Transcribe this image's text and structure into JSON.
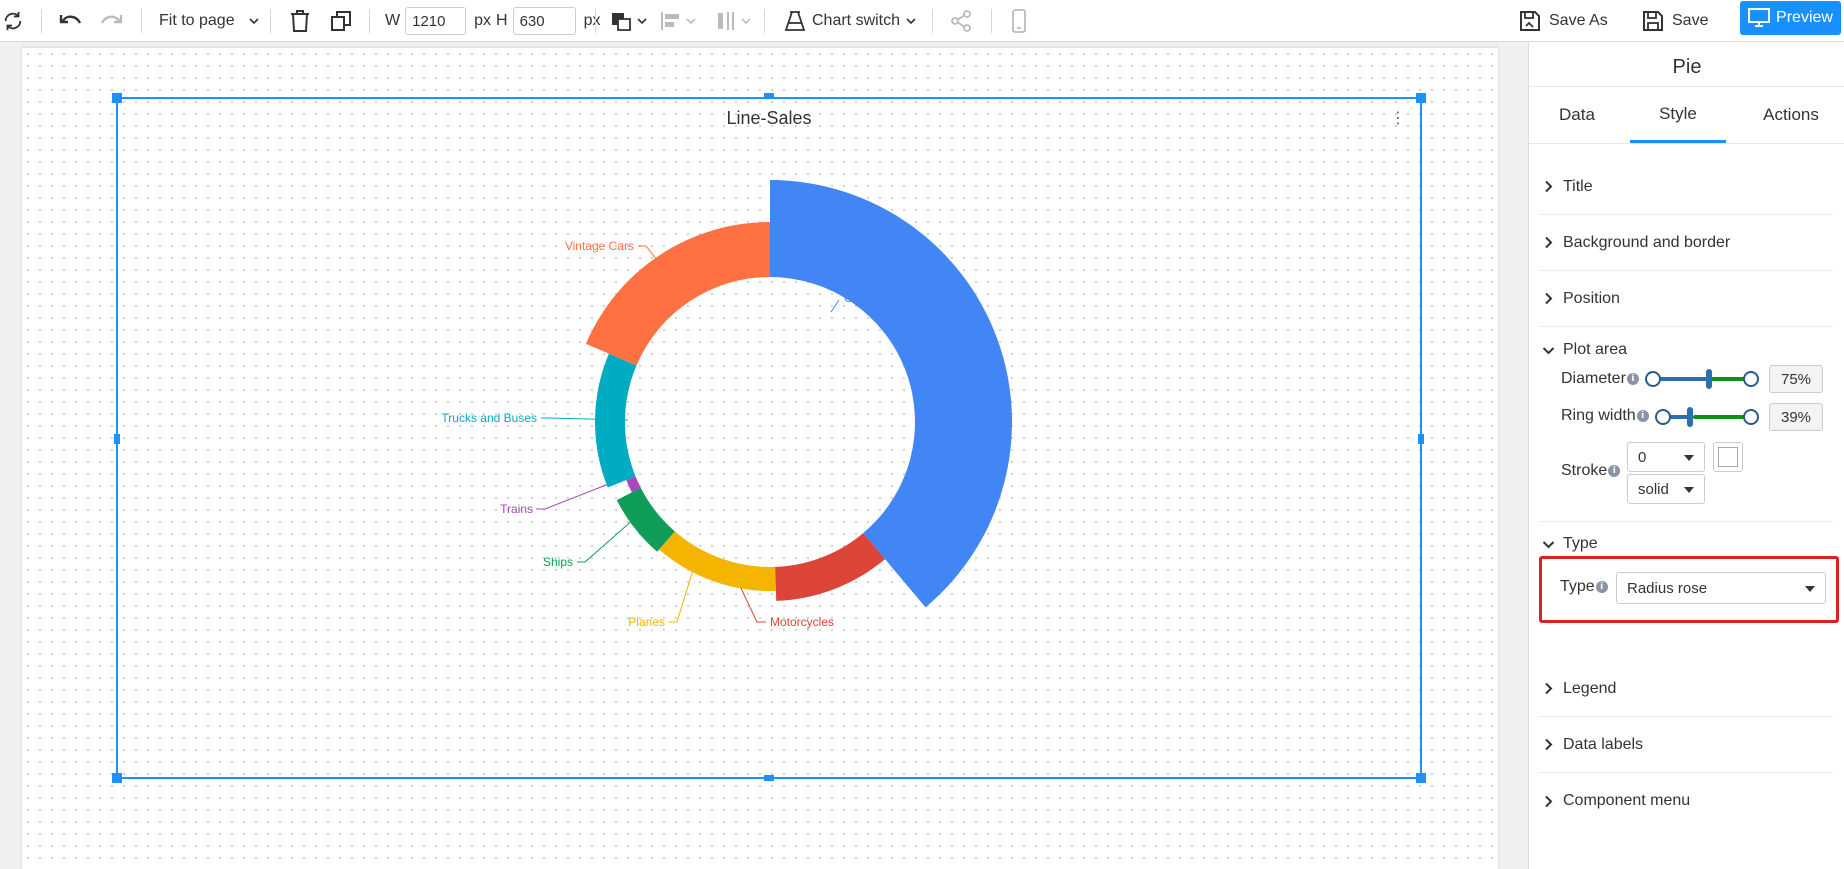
{
  "toolbar": {
    "fit_label": "Fit to page",
    "w_label": "W",
    "w_value": "1210",
    "h_label": "H",
    "h_value": "630",
    "unit": "px",
    "chart_switch_label": "Chart switch",
    "save_as_label": "Save As",
    "save_label": "Save",
    "preview_label": "Preview"
  },
  "chart_data": {
    "type": "pie",
    "subtype": "radius rose donut",
    "title": "Line-Sales",
    "categories": [
      "Classic Cars",
      "Motorcycles",
      "Planes",
      "Ships",
      "Trains",
      "Trucks and Buses",
      "Vintage Cars"
    ],
    "colors": [
      "#4285f4",
      "#db4437",
      "#f4b400",
      "#0f9d58",
      "#ab47bc",
      "#00acc1",
      "#ff7043"
    ]
  },
  "panel": {
    "title": "Pie",
    "tabs": [
      "Data",
      "Style",
      "Actions"
    ],
    "active_tab": "Style",
    "sections": {
      "title": "Title",
      "background": "Background and border",
      "position": "Position",
      "plot_area": "Plot area",
      "type": "Type",
      "legend": "Legend",
      "data_labels": "Data labels",
      "component_menu": "Component menu"
    },
    "plot_area": {
      "diameter_label": "Diameter",
      "diameter_value": "75%",
      "diameter_percent": 75,
      "ring_width_label": "Ring width",
      "ring_width_value": "39%",
      "ring_width_percent": 39,
      "stroke_label": "Stroke",
      "stroke_width": "0",
      "stroke_style": "solid"
    },
    "type_row": {
      "label": "Type",
      "value": "Radius rose"
    }
  }
}
